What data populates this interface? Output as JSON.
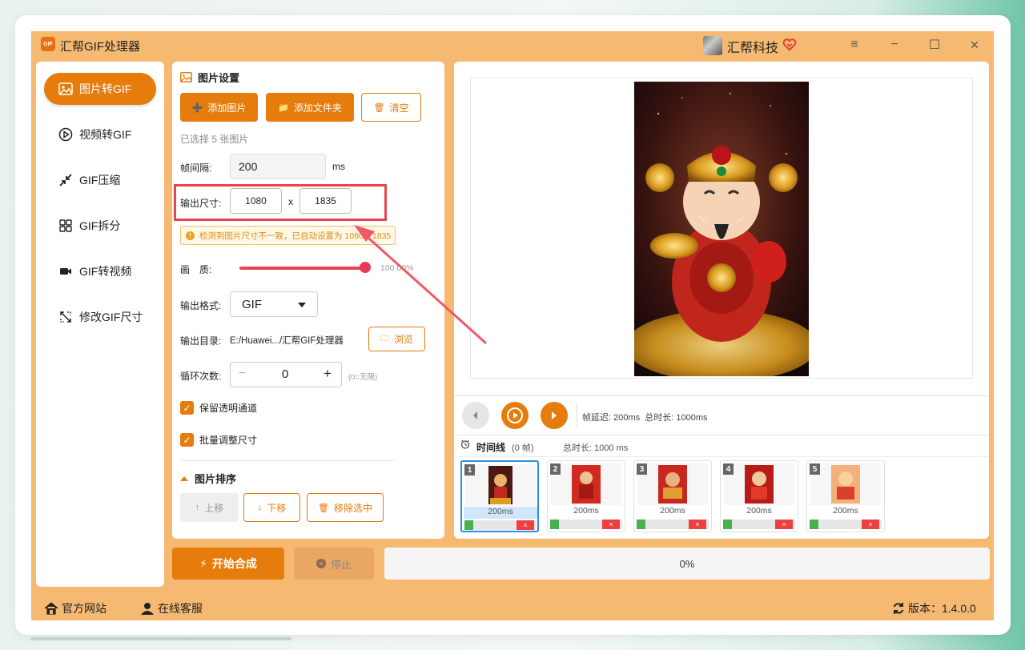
{
  "app": {
    "title": "汇帮GIF处理器",
    "logo_text": "GIF",
    "company": "汇帮科技"
  },
  "window_controls": {
    "menu": "≡",
    "minimize": "−",
    "maximize": "☐",
    "close": "✕"
  },
  "sidebar": {
    "items": [
      {
        "label": "图片转GIF",
        "icon": "image-icon",
        "active": true
      },
      {
        "label": "视频转GIF",
        "icon": "play-circle-icon",
        "active": false
      },
      {
        "label": "GIF压缩",
        "icon": "compress-icon",
        "active": false
      },
      {
        "label": "GIF拆分",
        "icon": "split-icon",
        "active": false
      },
      {
        "label": "GIF转视频",
        "icon": "video-icon",
        "active": false
      },
      {
        "label": "修改GIF尺寸",
        "icon": "resize-icon",
        "active": false
      }
    ]
  },
  "settings": {
    "section_title": "图片设置",
    "add_image": "添加图片",
    "add_folder": "添加文件夹",
    "clear": "清空",
    "selected_count": "已选择 5 张图片",
    "interval_label": "帧间隔:",
    "interval_value": "200",
    "interval_unit": "ms",
    "size_label": "输出尺寸:",
    "width": "1080",
    "size_x": "x",
    "height": "1835",
    "warning": "检测到图片尺寸不一致，已自动设置为 1080 x 1835",
    "quality_label": "画　质:",
    "quality_value": "100.00%",
    "quality_level": 1.0,
    "format_label": "输出格式:",
    "format_value": "GIF",
    "dir_label": "输出目录:",
    "dir_value": "E:/Huawei.../汇帮GIF处理器",
    "browse": "浏览",
    "loop_label": "循环次数:",
    "loop_minus": "−",
    "loop_value": "0",
    "loop_plus": "+",
    "loop_hint": "(0=无限)",
    "keep_alpha": "保留透明通道",
    "batch_resize": "批量调整尺寸",
    "sort_title": "图片排序",
    "move_up": "上移",
    "move_down": "下移",
    "remove_selected": "移除选中"
  },
  "player": {
    "info": "帧延迟: 200ms  总时长: 1000ms",
    "timeline_label": "时间线",
    "frame_count": "(0 帧)",
    "total": "总时长: 1000 ms"
  },
  "thumbnails": [
    {
      "num": "1",
      "ms": "200ms",
      "remove": "×",
      "selected": true
    },
    {
      "num": "2",
      "ms": "200ms",
      "remove": "×",
      "selected": false
    },
    {
      "num": "3",
      "ms": "200ms",
      "remove": "×",
      "selected": false
    },
    {
      "num": "4",
      "ms": "200ms",
      "remove": "×",
      "selected": false
    },
    {
      "num": "5",
      "ms": "200ms",
      "remove": "×",
      "selected": false
    }
  ],
  "actions": {
    "start": "开始合成",
    "stop": "停止",
    "progress": "0%"
  },
  "footer": {
    "website": "官方网站",
    "support": "在线客服",
    "version": "版本：1.4.0.0"
  },
  "colors": {
    "accent": "#e57c0c",
    "window_bg": "#f6b971",
    "highlight": "#e8444e"
  }
}
